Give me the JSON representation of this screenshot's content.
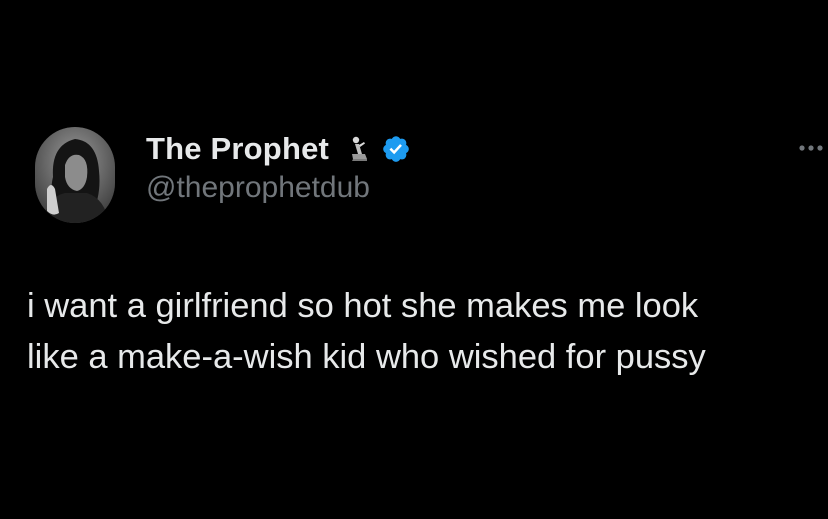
{
  "tweet": {
    "author": {
      "display_name": "The Prophet",
      "handle": "@theprophetdub",
      "name_emoji": "praying-figure-icon",
      "verified": true,
      "verified_color": "#1d9bf0"
    },
    "text": "i want a girlfriend so hot she makes me look\nlike a make-a-wish kid who wished for pussy",
    "more_icon": "ellipsis-icon"
  },
  "colors": {
    "background": "#000000",
    "primary_text": "#e7e9ea",
    "secondary_text": "#71767b",
    "accent": "#1d9bf0"
  }
}
